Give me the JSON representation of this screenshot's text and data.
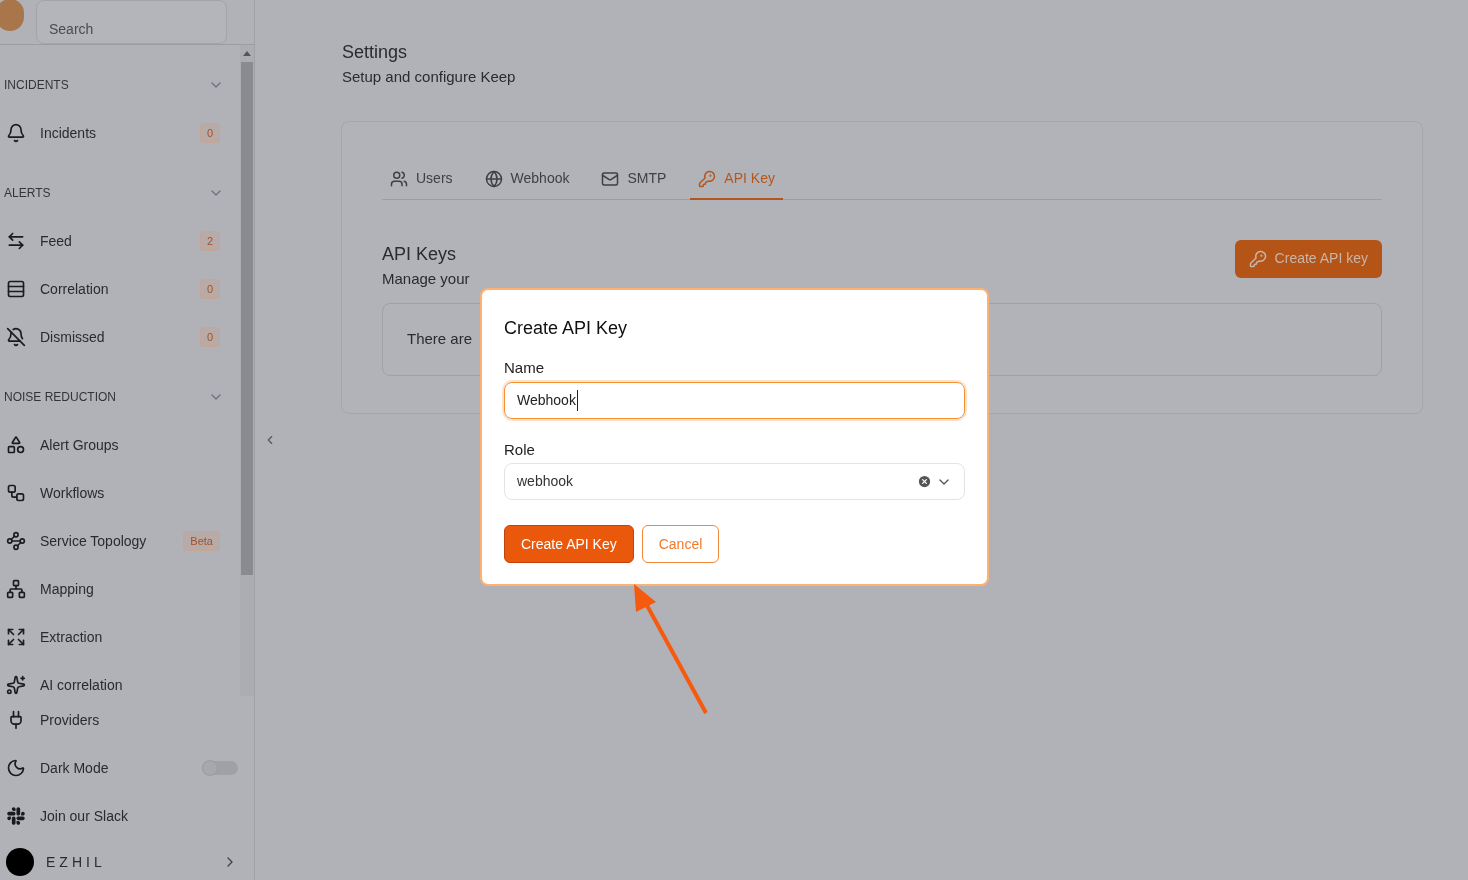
{
  "sidebar": {
    "search": {
      "placeholder": "Search"
    },
    "sections": [
      {
        "title": "INCIDENTS",
        "expanded": true,
        "items": [
          {
            "label": "Incidents",
            "badge": "0"
          }
        ]
      },
      {
        "title": "ALERTS",
        "expanded": true,
        "items": [
          {
            "label": "Feed",
            "badge": "2"
          },
          {
            "label": "Correlation",
            "badge": "0"
          },
          {
            "label": "Dismissed",
            "badge": "0"
          }
        ]
      },
      {
        "title": "NOISE REDUCTION",
        "expanded": true,
        "items": [
          {
            "label": "Alert Groups"
          },
          {
            "label": "Workflows"
          },
          {
            "label": "Service Topology",
            "badge": "Beta"
          },
          {
            "label": "Mapping"
          },
          {
            "label": "Extraction"
          },
          {
            "label": "AI correlation"
          }
        ]
      }
    ],
    "bottom_items": [
      {
        "label": "Providers",
        "kind": "link"
      },
      {
        "label": "Dark Mode",
        "kind": "toggle",
        "on": false
      },
      {
        "label": "Join our Slack",
        "kind": "link"
      }
    ],
    "user": {
      "name": "EZHIL"
    }
  },
  "page": {
    "title": "Settings",
    "subtitle": "Setup and configure Keep"
  },
  "tabs": [
    {
      "label": "Users",
      "selected": false
    },
    {
      "label": "Webhook",
      "selected": false
    },
    {
      "label": "SMTP",
      "selected": false
    },
    {
      "label": "API Key",
      "selected": true
    }
  ],
  "api_keys": {
    "title": "API Keys",
    "description": "Manage your",
    "create_button": "Create API key",
    "empty_text": "There are"
  },
  "modal": {
    "title": "Create API Key",
    "name_label": "Name",
    "name_value": "Webhook",
    "role_label": "Role",
    "role_value": "webhook",
    "primary_button": "Create API Key",
    "cancel_button": "Cancel"
  }
}
